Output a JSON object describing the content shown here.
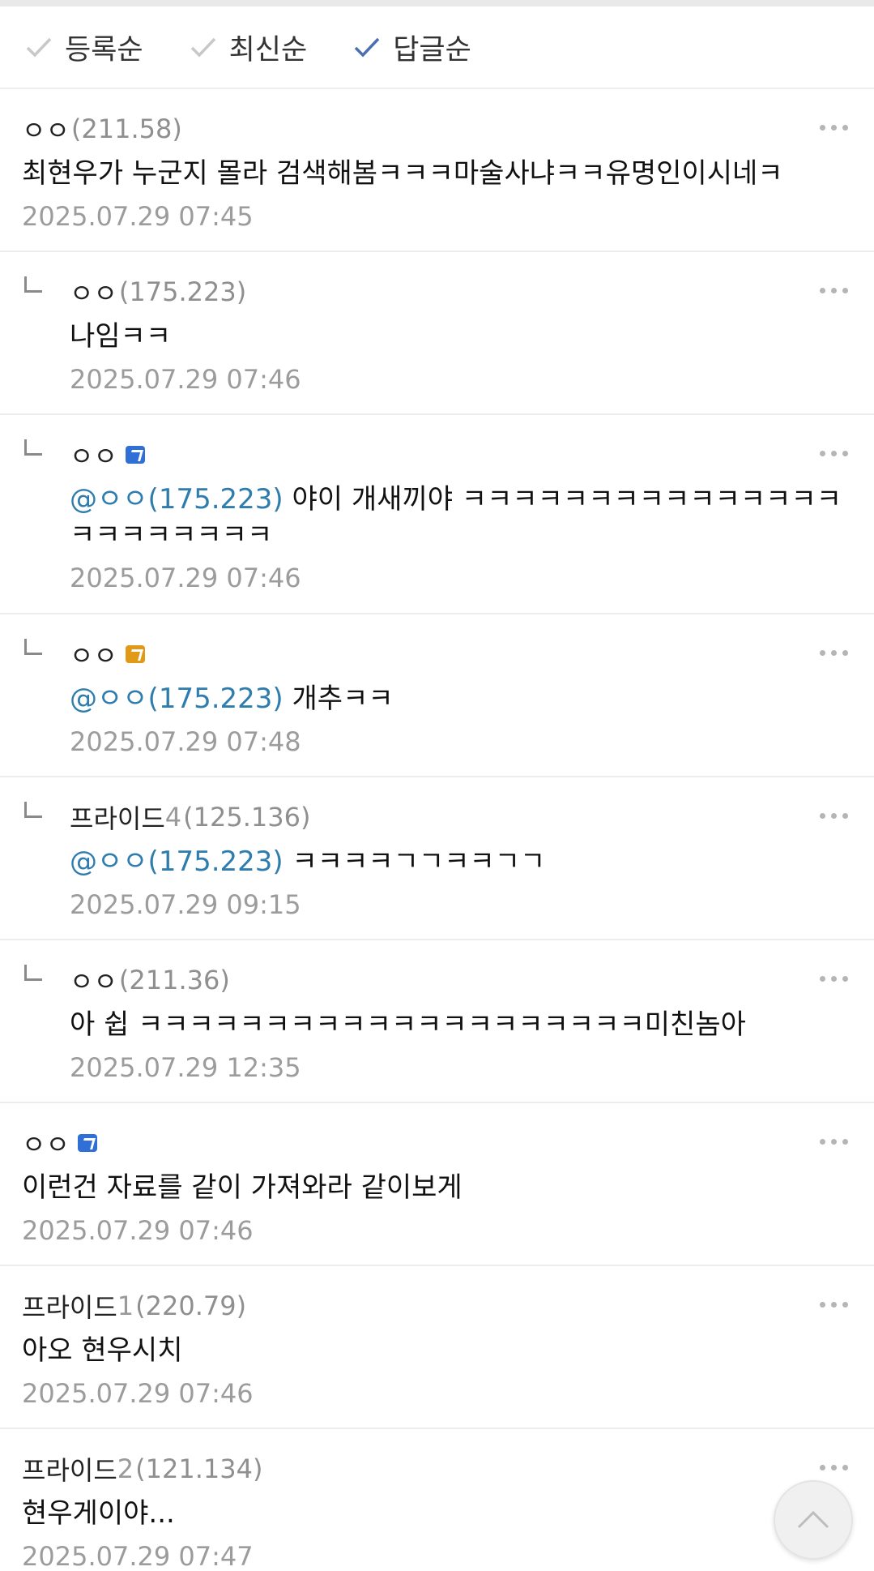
{
  "sort": {
    "items": [
      {
        "label": "등록순",
        "active": false
      },
      {
        "label": "최신순",
        "active": false
      },
      {
        "label": "답글순",
        "active": true
      }
    ]
  },
  "comments": [
    {
      "nick": "ㅇㅇ",
      "ip": "(211.58)",
      "text": "최현우가 누군지 몰라 검색해봄ㅋㅋㅋ마술사냐ㅋㅋ유명인이시네ㅋ",
      "date": "2025.07.29 07:45"
    },
    {
      "nick": "ㅇㅇ",
      "ip": "(175.223)",
      "text": "나임ㅋㅋ",
      "date": "2025.07.29 07:46"
    },
    {
      "nick": "ㅇㅇ",
      "badge": "blue",
      "mention": "@ㅇㅇ(175.223)",
      "text": " 야이 개새끼야 ㅋㅋㅋㅋㅋㅋㅋㅋㅋㅋㅋㅋㅋㅋㅋㅋㅋㅋㅋㅋㅋㅋㅋ",
      "date": "2025.07.29 07:46"
    },
    {
      "nick": "ㅇㅇ",
      "badge": "gold",
      "mention": "@ㅇㅇ(175.223)",
      "text": " 개추ㅋㅋ",
      "date": "2025.07.29 07:48"
    },
    {
      "nick": "프라이드",
      "nick_num": "4",
      "ip": "(125.136)",
      "mention": "@ㅇㅇ(175.223)",
      "text": " ㅋㅋㅋㅋㄱㄱㅋㅋㄱㄱ",
      "date": "2025.07.29 09:15"
    },
    {
      "nick": "ㅇㅇ",
      "ip": "(211.36)",
      "text": "아 쉽 ㅋㅋㅋㅋㅋㅋㅋㅋㅋㅋㅋㅋㅋㅋㅋㅋㅋㅋㅋㅋ미친놈아",
      "date": "2025.07.29 12:35"
    },
    {
      "nick": "ㅇㅇ",
      "badge": "blue",
      "text": "이런건 자료를 같이 가져와라 같이보게",
      "date": "2025.07.29 07:46"
    },
    {
      "nick": "프라이드",
      "nick_num": "1",
      "ip": "(220.79)",
      "text": "아오 현우시치",
      "date": "2025.07.29 07:46"
    },
    {
      "nick": "프라이드",
      "nick_num": "2",
      "ip": "(121.134)",
      "text": "현우게이야...",
      "date": "2025.07.29 07:47"
    }
  ],
  "colors": {
    "check_active": "#4a6fb5",
    "check_inactive": "#c8c8c8",
    "mention": "#2e7dae",
    "badge_blue": "#2f6fd6",
    "badge_gold": "#e09a18"
  }
}
